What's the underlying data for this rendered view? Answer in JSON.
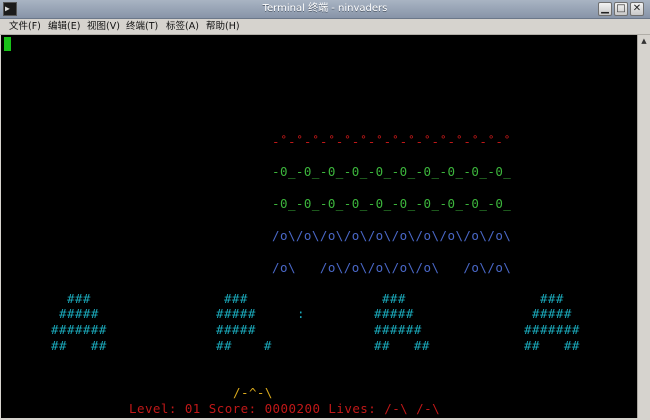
{
  "window": {
    "title": "Terminal 终端 - ninvaders",
    "app_icon": "terminal-icon",
    "controls": {
      "minimize": "□",
      "maximize": "□",
      "close": "✕"
    }
  },
  "menu": [
    "文件(F)",
    "编辑(E)",
    "视图(V)",
    "终端(T)",
    "标签(A)",
    "帮助(H)"
  ],
  "game": {
    "ufo_row": "-˚-˚-˚-˚-˚-˚-˚-˚-˚-˚-˚-˚-˚-˚-˚",
    "rows": [
      {
        "text": "-0_-0_-0_-0_-0_-0_-0_-0_-0_-0_",
        "color": "#3cb53c"
      },
      {
        "text": "-0_-0_-0_-0_-0_-0_-0_-0_-0_-0_",
        "color": "#3cb53c"
      },
      {
        "text": "/o\\/o\\/o\\/o\\/o\\/o\\/o\\/o\\/o\\/o\\",
        "color": "#4a68c8"
      },
      {
        "text": "/o\\   /o\\/o\\/o\\/o\\/o\\   /o\\/o\\",
        "color": "#4a68c8"
      }
    ],
    "bunkers": [
      [
        "  ###",
        " #####",
        "#######",
        "##   ##"
      ],
      [
        "  ###",
        " #####",
        " #####",
        " ##    #"
      ],
      [
        "  ###",
        " #####",
        " ######",
        " ##   ##"
      ],
      [
        "  ###",
        " #####",
        "#######",
        "##   ##"
      ]
    ],
    "bullet": ":",
    "player": "/-^-\\",
    "status_line": "Level: 01 Score: 0000200 Lives: /-\\ /-\\"
  },
  "colors": {
    "ufo": "#c01818",
    "invader_green": "#3cb53c",
    "invader_blue": "#4a68c8",
    "bunker": "#1aa7b8",
    "player": "#d8a81c",
    "status": "#c01818",
    "cursor": "#19c119",
    "terminal_bg": "#000000"
  }
}
